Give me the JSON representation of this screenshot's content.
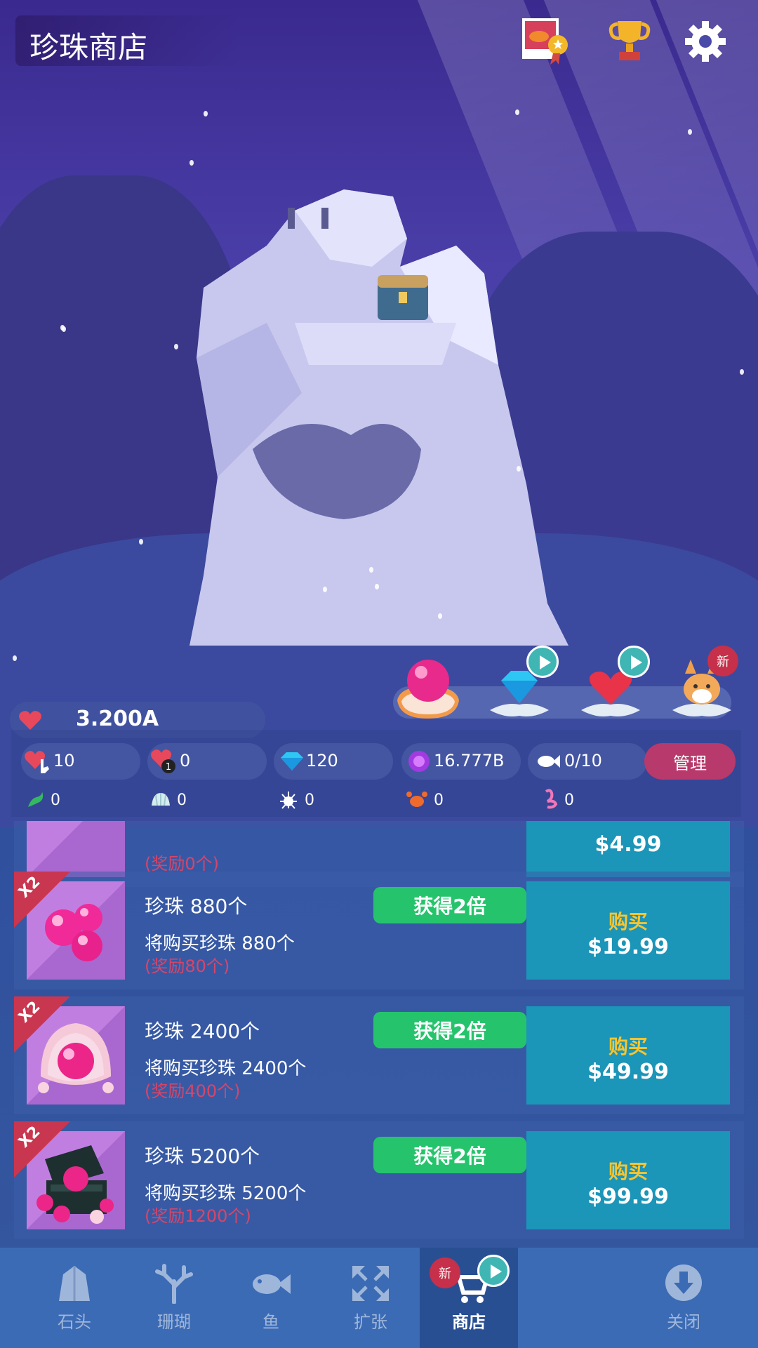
{
  "header": {
    "title": "珍珠商店",
    "icons": [
      "photo-badge-icon",
      "trophy-icon",
      "gear-icon"
    ]
  },
  "categories": [
    {
      "name": "pearl",
      "icon": "pearl-shell-icon",
      "selected": true
    },
    {
      "name": "diamond",
      "icon": "diamond-shell-icon",
      "badge": "play"
    },
    {
      "name": "heart",
      "icon": "heart-shell-icon",
      "badge": "play"
    },
    {
      "name": "corgi",
      "icon": "corgi-shell-icon",
      "badge": "新"
    }
  ],
  "status": {
    "hearts": "3.200A",
    "chips": [
      {
        "icon": "heart-tap-icon",
        "value": "10"
      },
      {
        "icon": "heart-timer-icon",
        "value": "0"
      },
      {
        "icon": "diamond-icon",
        "value": "120"
      },
      {
        "icon": "pearl-icon",
        "value": "16.777B"
      },
      {
        "icon": "fish-icon",
        "value": "0/10"
      }
    ],
    "manage_label": "管理",
    "resources": [
      {
        "icon": "seaweed-icon",
        "value": "0"
      },
      {
        "icon": "shell-icon",
        "value": "0"
      },
      {
        "icon": "urchin-icon",
        "value": "0"
      },
      {
        "icon": "crab-icon",
        "value": "0"
      },
      {
        "icon": "flamingo-icon",
        "value": "0"
      }
    ]
  },
  "offers": [
    {
      "name": "",
      "desc": "",
      "bonus": "(奖励0个)",
      "price": "$4.99",
      "buy_label": "",
      "x2": false,
      "double_label": ""
    },
    {
      "name": "珍珠 880个",
      "desc": "将购买珍珠 880个",
      "bonus": "(奖励80个)",
      "price": "$19.99",
      "buy_label": "购买",
      "x2": true,
      "double_label": "获得2倍"
    },
    {
      "name": "珍珠 2400个",
      "desc": "将购买珍珠 2400个",
      "bonus": "(奖励400个)",
      "price": "$49.99",
      "buy_label": "购买",
      "x2": true,
      "double_label": "获得2倍"
    },
    {
      "name": "珍珠 5200个",
      "desc": "将购买珍珠 5200个",
      "bonus": "(奖励1200个)",
      "price": "$99.99",
      "buy_label": "购买",
      "x2": true,
      "double_label": "获得2倍"
    }
  ],
  "x2_tag": "X2",
  "nav": [
    {
      "label": "石头",
      "icon": "rock-icon",
      "active": false
    },
    {
      "label": "珊瑚",
      "icon": "coral-icon",
      "active": false
    },
    {
      "label": "鱼",
      "icon": "fish-icon",
      "active": false
    },
    {
      "label": "扩张",
      "icon": "expand-icon",
      "active": false
    },
    {
      "label": "商店",
      "icon": "cart-icon",
      "active": true,
      "badge": "新"
    },
    {
      "label": "关闭",
      "icon": "download-icon",
      "active": false
    }
  ],
  "colors": {
    "accent": "#25c46c",
    "buy": "#1b95b8",
    "manage": "#b8396b",
    "bonus": "#d5466a"
  }
}
